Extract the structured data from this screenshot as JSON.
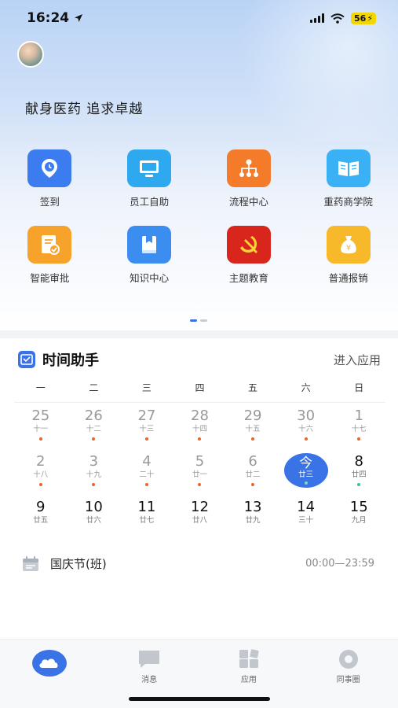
{
  "status_bar": {
    "time": "16:24",
    "battery": "56"
  },
  "header": {
    "slogan": "献身医药 追求卓越"
  },
  "apps": [
    {
      "label": "签到",
      "icon": "location-clock-icon",
      "color": "#3b7cf0"
    },
    {
      "label": "员工自助",
      "icon": "monitor-icon",
      "color": "#2ea8ef"
    },
    {
      "label": "流程中心",
      "icon": "org-chart-icon",
      "color": "#f47b2a"
    },
    {
      "label": "重药商学院",
      "icon": "book-icon",
      "color": "#3ab0f5"
    },
    {
      "label": "智能审批",
      "icon": "document-check-icon",
      "color": "#f7a22a"
    },
    {
      "label": "知识中心",
      "icon": "book-stack-icon",
      "color": "#3b8ef0"
    },
    {
      "label": "主题教育",
      "icon": "party-emblem-icon",
      "color": "#d9261c"
    },
    {
      "label": "普通报销",
      "icon": "money-bag-icon",
      "color": "#f7b82a"
    }
  ],
  "time_assistant": {
    "title": "时间助手",
    "link": "进入应用",
    "weekdays": [
      "一",
      "二",
      "三",
      "四",
      "五",
      "六",
      "日"
    ],
    "weeks": [
      [
        {
          "num": "25",
          "lunar": "十一",
          "dot": "#e8652b",
          "state": "prev"
        },
        {
          "num": "26",
          "lunar": "十二",
          "dot": "#e8652b",
          "state": "prev"
        },
        {
          "num": "27",
          "lunar": "十三",
          "dot": "#e8652b",
          "state": "prev"
        },
        {
          "num": "28",
          "lunar": "十四",
          "dot": "#e8652b",
          "state": "prev"
        },
        {
          "num": "29",
          "lunar": "十五",
          "dot": "#e8652b",
          "state": "prev"
        },
        {
          "num": "30",
          "lunar": "十六",
          "dot": "#e8652b",
          "state": "prev"
        },
        {
          "num": "1",
          "lunar": "十七",
          "dot": "#e8652b",
          "state": "prev"
        }
      ],
      [
        {
          "num": "2",
          "lunar": "十八",
          "dot": "#e8652b",
          "state": "prev"
        },
        {
          "num": "3",
          "lunar": "十九",
          "dot": "#e8652b",
          "state": "prev"
        },
        {
          "num": "4",
          "lunar": "二十",
          "dot": "#e8652b",
          "state": "prev"
        },
        {
          "num": "5",
          "lunar": "廿一",
          "dot": "#e8652b",
          "state": "prev"
        },
        {
          "num": "6",
          "lunar": "廿二",
          "dot": "#e8652b",
          "state": "prev"
        },
        {
          "num": "今",
          "lunar": "廿三",
          "dot": "#7fd9c0",
          "state": "today"
        },
        {
          "num": "8",
          "lunar": "廿四",
          "dot": "#35c48e",
          "state": "cur"
        }
      ],
      [
        {
          "num": "9",
          "lunar": "廿五",
          "dot": "",
          "state": "cur"
        },
        {
          "num": "10",
          "lunar": "廿六",
          "dot": "",
          "state": "cur"
        },
        {
          "num": "11",
          "lunar": "廿七",
          "dot": "",
          "state": "cur"
        },
        {
          "num": "12",
          "lunar": "廿八",
          "dot": "",
          "state": "cur"
        },
        {
          "num": "13",
          "lunar": "廿九",
          "dot": "",
          "state": "cur"
        },
        {
          "num": "14",
          "lunar": "三十",
          "dot": "",
          "state": "cur"
        },
        {
          "num": "15",
          "lunar": "九月",
          "dot": "",
          "state": "cur"
        }
      ]
    ],
    "event": {
      "name": "国庆节(班)",
      "time": "00:00—23:59"
    }
  },
  "tabbar": [
    {
      "label": "",
      "icon": "cloud-home-icon",
      "active": true
    },
    {
      "label": "消息",
      "icon": "message-icon"
    },
    {
      "label": "应用",
      "icon": "apps-grid-icon"
    },
    {
      "label": "同事圈",
      "icon": "colleague-circle-icon"
    }
  ],
  "colors": {
    "accent": "#3a73e6",
    "event_dot": "#e8652b",
    "today_dot": "#35c48e"
  }
}
